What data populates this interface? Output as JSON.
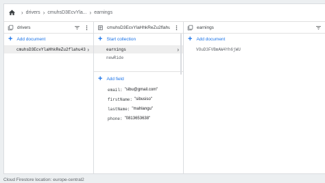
{
  "breadcrumb": [
    "drivers",
    "cmuhsD3EcvYla...",
    "earnings"
  ],
  "panels": [
    {
      "title": "drivers",
      "action": "Add document",
      "items": [
        {
          "label": "cmuhsD3EcvYlaHhkReZu2flahu43",
          "selected": true
        }
      ]
    },
    {
      "title": "cmuhsD3EcvYlaHhkReZu2flahu43",
      "action": "Start collection",
      "items": [
        {
          "label": "earnings",
          "selected": true
        },
        {
          "label": "newRide",
          "selected": false
        }
      ],
      "field_action": "Add field",
      "fields": [
        {
          "key": "email:",
          "value": "\"sibu@gmail.com\""
        },
        {
          "key": "firstName:",
          "value": "\"sibusiso\""
        },
        {
          "key": "lastName:",
          "value": "\"mahlangu\""
        },
        {
          "key": "phone:",
          "value": "\"0813653638\""
        }
      ]
    },
    {
      "title": "earnings",
      "action": "Add document",
      "items": [
        {
          "label": "VOuD3FVBmAW4Yh6jWU",
          "selected": false
        }
      ]
    }
  ],
  "footer": "Cloud Firestore location: europe-central2",
  "icons": {
    "home": "home-icon",
    "collection": "collection-icon",
    "document": "document-icon",
    "filter": "filter-icon",
    "more": "more-vert-icon"
  }
}
